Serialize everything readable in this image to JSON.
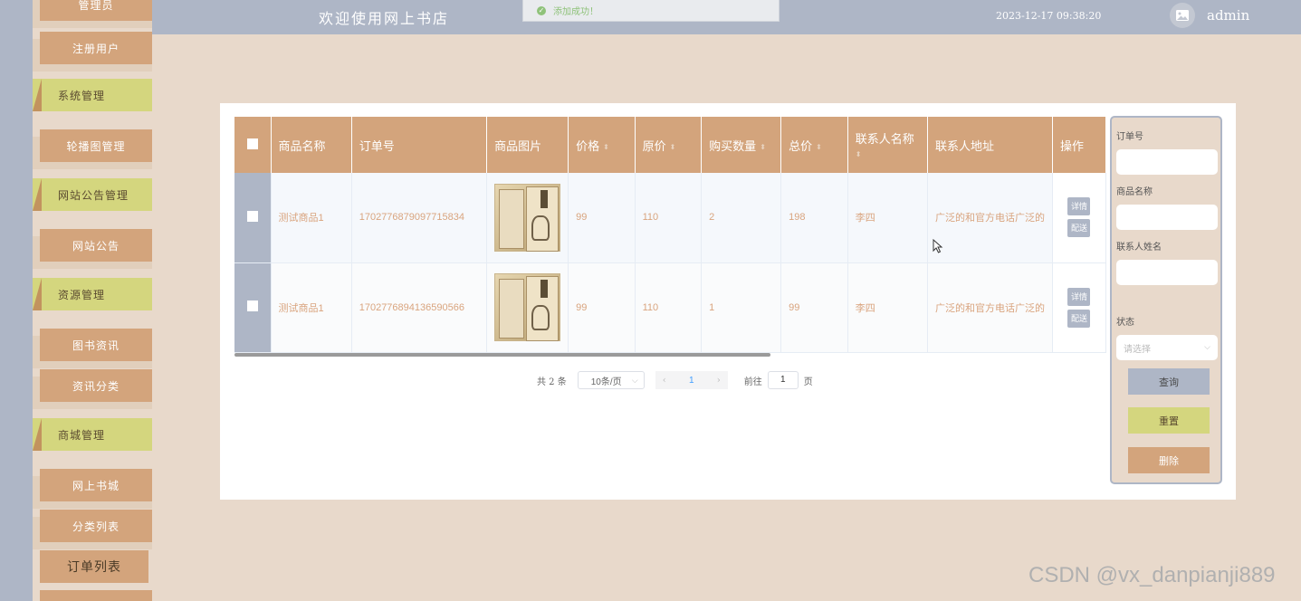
{
  "header": {
    "title": "欢迎使用网上书店",
    "datetime": "2023-12-17 09:38:20",
    "username": "admin",
    "toast": "添加成功！"
  },
  "sidebar": {
    "items": [
      {
        "label": "管理员",
        "kind": "sub"
      },
      {
        "label": "注册用户",
        "kind": "sub"
      },
      {
        "label": "系统管理",
        "kind": "group"
      },
      {
        "label": "轮播图管理",
        "kind": "sub"
      },
      {
        "label": "网站公告管理",
        "kind": "group"
      },
      {
        "label": "网站公告",
        "kind": "sub"
      },
      {
        "label": "资源管理",
        "kind": "group"
      },
      {
        "label": "图书资讯",
        "kind": "sub"
      },
      {
        "label": "资讯分类",
        "kind": "sub"
      },
      {
        "label": "商城管理",
        "kind": "group"
      },
      {
        "label": "网上书城",
        "kind": "sub"
      },
      {
        "label": "分类列表",
        "kind": "sub"
      },
      {
        "label": "订单列表",
        "kind": "sub",
        "current": true
      }
    ]
  },
  "table": {
    "columns": [
      "商品名称",
      "订单号",
      "商品图片",
      "价格",
      "原价",
      "购买数量",
      "总价",
      "联系人名称",
      "联系人地址",
      "操作"
    ],
    "rows": [
      {
        "name": "测试商品1",
        "order_no": "1702776879097715834",
        "price": "99",
        "original_price": "110",
        "qty": "2",
        "total": "198",
        "contact": "李四",
        "address": "广泛的和官方电话广泛的"
      },
      {
        "name": "测试商品1",
        "order_no": "1702776894136590566",
        "price": "99",
        "original_price": "110",
        "qty": "1",
        "total": "99",
        "contact": "李四",
        "address": "广泛的和官方电话广泛的"
      }
    ],
    "op_detail": "详情",
    "op_ship": "配送"
  },
  "pagination": {
    "total": "共 2 条",
    "page_size": "10条/页",
    "current_page": "1",
    "goto_prefix": "前往",
    "goto_value": "1",
    "goto_suffix": "页"
  },
  "search": {
    "order_no_label": "订单号",
    "product_name_label": "商品名称",
    "contact_name_label": "联系人姓名",
    "status_label": "状态",
    "status_placeholder": "请选择",
    "query_button": "查询",
    "reset_button": "重置",
    "delete_button": "删除"
  },
  "watermark": "CSDN @vx_danpianji889",
  "colors": {
    "header_bg": "#aeb6c6",
    "accent": "#d3a47c",
    "group_item": "#d4d67e",
    "page_bg": "#e8d9cb"
  }
}
